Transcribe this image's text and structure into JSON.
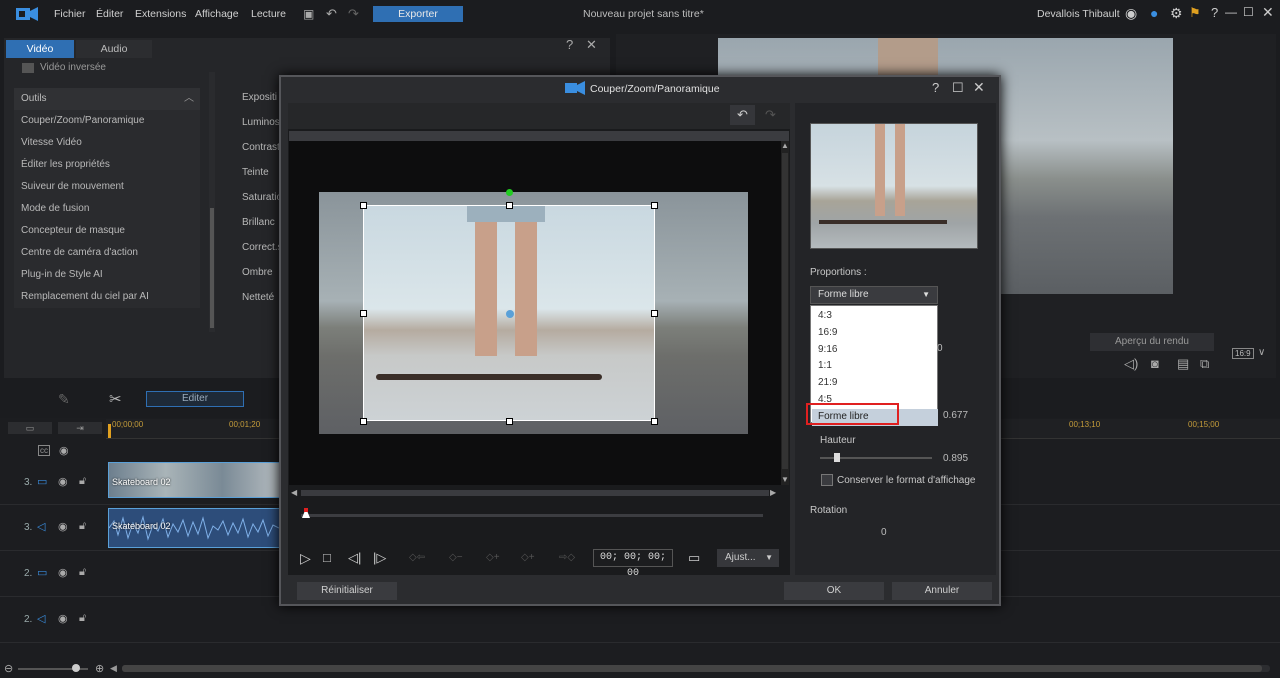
{
  "menubar": {
    "items": [
      "Fichier",
      "Éditer",
      "Extensions",
      "Affichage",
      "Lecture"
    ],
    "export_label": "Exporter",
    "project_title": "Nouveau projet sans titre*",
    "user": "Devallois Thibault"
  },
  "left_panel": {
    "tabs": [
      "Vidéo",
      "Audio"
    ],
    "inverted_video": "Vidéo inversée",
    "section": "Outils",
    "tools": [
      "Couper/Zoom/Panoramique",
      "Vitesse Vidéo",
      "Éditer les propriétés",
      "Suiveur de mouvement",
      "Mode de fusion",
      "Concepteur de masque",
      "Centre de caméra d'action",
      "Plug-in de Style AI",
      "Remplacement du ciel par AI"
    ],
    "params": [
      "Expositi",
      "Luminos",
      "Contrast",
      "Teinte",
      "Saturatio",
      "Brillanc",
      "Correct.s",
      "Ombre",
      "Netteté"
    ]
  },
  "preview": {
    "render_label": "Aperçu du rendu",
    "ratio": "16:9"
  },
  "toolbar": {
    "edit_label": "Editer"
  },
  "timeline": {
    "times": [
      "00;00;00",
      "00;01;20",
      "00;13;10",
      "00;15;00"
    ],
    "tracks": [
      {
        "num": "3.",
        "type": "video",
        "clip": "Skateboard 02"
      },
      {
        "num": "3.",
        "type": "audio",
        "clip": "Skateboard 02"
      },
      {
        "num": "2.",
        "type": "video",
        "clip": ""
      },
      {
        "num": "2.",
        "type": "audio",
        "clip": ""
      }
    ]
  },
  "dialog": {
    "title": "Couper/Zoom/Panoramique",
    "timecode": "00; 00; 00; 00",
    "fit_label": "Ajust...",
    "reset_label": "Réinitialiser",
    "ok_label": "OK",
    "cancel_label": "Annuler",
    "proportions_label": "Proportions :",
    "proportions_selected": "Forme libre",
    "proportions_options": [
      "4:3",
      "16:9",
      "9:16",
      "1:1",
      "21:9",
      "4:5",
      "Forme libre"
    ],
    "width_value": "0.677",
    "height_label": "Hauteur",
    "height_value": "0.895",
    "keep_ratio_label": "Conserver le format d'affichage",
    "rotation_label": "Rotation",
    "rotation_value": "0",
    "hidden_value": "0"
  },
  "colors": {
    "accent": "#2f6fb3",
    "highlight": "#e02020",
    "handle_green": "#22cc22",
    "handle_blue": "#5aa0d8"
  }
}
